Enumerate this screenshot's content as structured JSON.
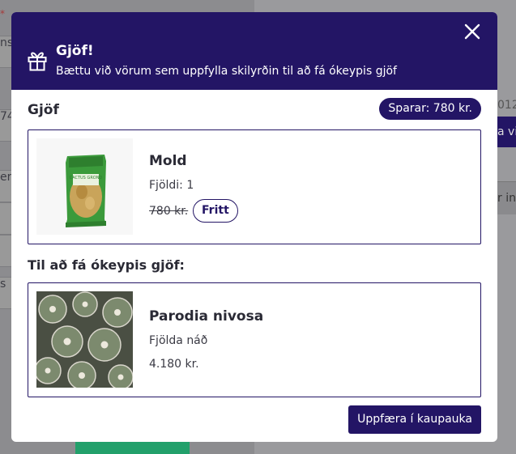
{
  "background": {
    "left_fragments": [
      "ns",
      "74",
      "er",
      "s"
    ],
    "right_fragments": [
      "012",
      "a við",
      "r inn"
    ]
  },
  "modal": {
    "title": "Gjöf!",
    "subtitle": "Bættu við vörum sem uppfylla skilyrðin til að fá ókeypis gjöf",
    "section_title": "Gjöf",
    "savings_label": "Sparar: 780 kr.",
    "gift_item": {
      "name": "Mold",
      "quantity": "Fjöldi: 1",
      "old_price": "780 kr.",
      "free_label": "Fritt",
      "package_text": "CACTUS GROND"
    },
    "requirement_title": "Til að fá ókeypis gjöf:",
    "required_item": {
      "name": "Parodia nivosa",
      "status": "Fjölda náð",
      "price": "4.180 kr."
    },
    "update_button": "Uppfæra í kaupauka"
  },
  "colors": {
    "brand": "#231565",
    "overlay_green": "#22a06b"
  }
}
